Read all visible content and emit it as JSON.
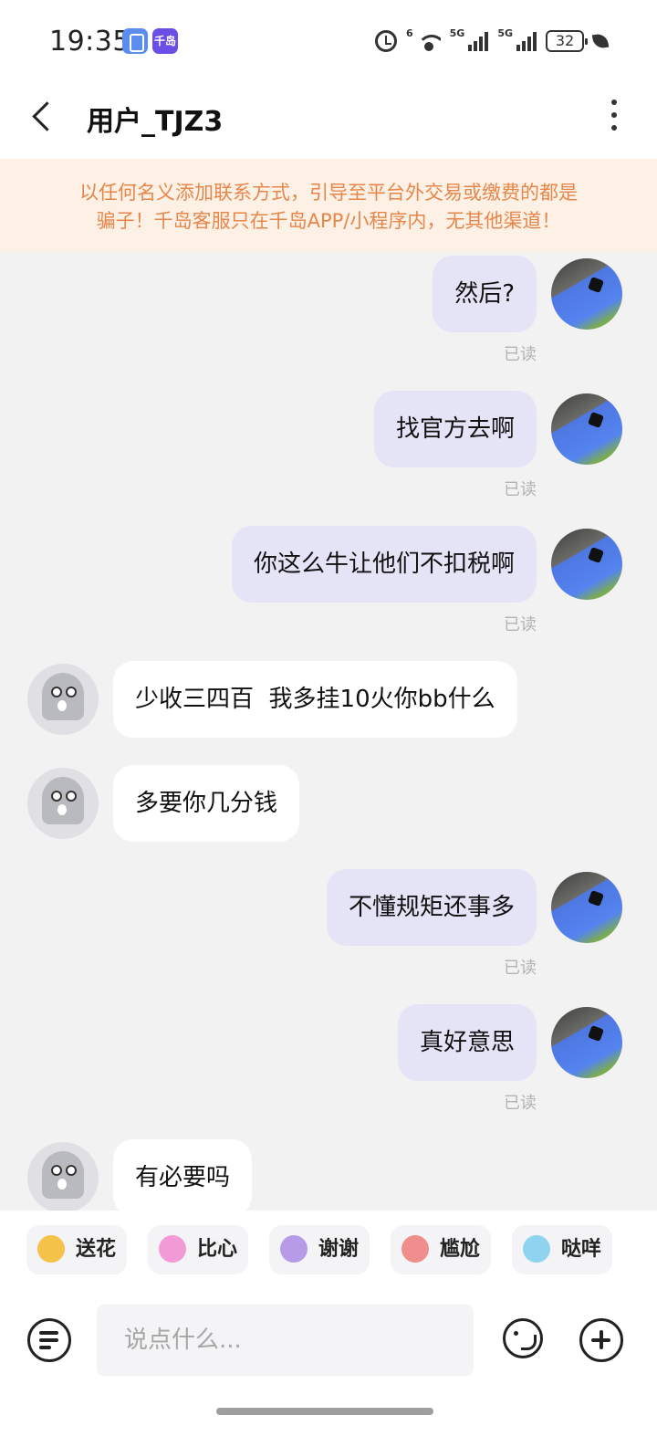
{
  "status_bar": {
    "time": "19:35",
    "app_icon_2_text": "千岛",
    "network_1": "6",
    "network_2": "5G",
    "network_3": "5G",
    "battery": "32"
  },
  "header": {
    "title": "用户_TJZ3"
  },
  "warning_banner": {
    "line1": "以任何名义添加联系方式，引导至平台外交易或缴费的都是",
    "line2": "骗子！千岛客服只在千岛APP/小程序内，无其他渠道！"
  },
  "messages": [
    {
      "text": "然后?",
      "status": "已读"
    },
    {
      "text": "找官方去啊",
      "status": "已读"
    },
    {
      "text": "你这么牛让他们不扣税啊",
      "status": "已读"
    },
    {
      "text": "少收三四百  我多挂10火你bb什么"
    },
    {
      "text": "多要你几分钱"
    },
    {
      "text": "不懂规矩还事多",
      "status": "已读"
    },
    {
      "text": "真好意思",
      "status": "已读"
    },
    {
      "text": "有必要吗"
    }
  ],
  "quick_replies": [
    {
      "label": "送花",
      "color": "#f6c34a"
    },
    {
      "label": "比心",
      "color": "#f29ad6"
    },
    {
      "label": "谢谢",
      "color": "#b79be8"
    },
    {
      "label": "尴尬",
      "color": "#f08e8e"
    },
    {
      "label": "哒咩",
      "color": "#8fd3ef"
    }
  ],
  "input": {
    "placeholder": "说点什么..."
  },
  "colors": {
    "outgoing_bubble": "#e5e3f6",
    "incoming_bubble": "#ffffff",
    "warning_text": "#e7864a",
    "warning_bg": "#fdf1e6"
  }
}
